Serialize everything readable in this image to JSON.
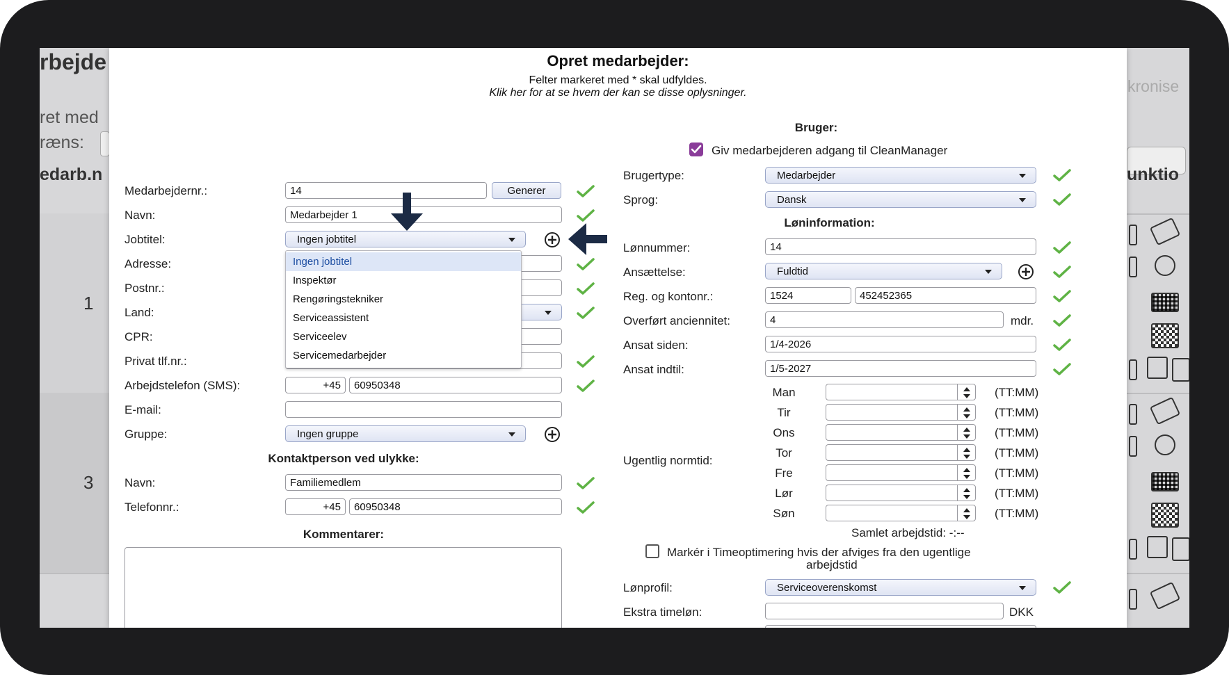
{
  "background": {
    "title_fragment": "rbejde",
    "create_fragment": "ret med",
    "limit_fragment": "ræns:",
    "column_fragment": "edarb.n",
    "sync_fragment": "kronise",
    "function_fragment": "unktio",
    "row_numbers": [
      "1",
      "3"
    ]
  },
  "modal": {
    "title": "Opret medarbejder:",
    "required_note": "Felter markeret med * skal udfyldes.",
    "visibility_link": "Klik her for at se hvem der kan se disse oplysninger.",
    "left": {
      "employee_no_label": "Medarbejdernr.:",
      "employee_no_value": "14",
      "generate_button": "Generer",
      "name_label": "Navn:",
      "name_value": "Medarbejder 1",
      "jobtitle_label": "Jobtitel:",
      "jobtitle_value": "Ingen jobtitel",
      "address_label": "Adresse:",
      "postal_label": "Postnr.:",
      "country_label": "Land:",
      "cpr_label": "CPR:",
      "private_phone_label": "Privat tlf.nr.:",
      "work_phone_label": "Arbejdstelefon (SMS):",
      "work_phone_prefix": "+45",
      "work_phone_value": "60950348",
      "email_label": "E-mail:",
      "group_label": "Gruppe:",
      "group_value": "Ingen gruppe",
      "contact_heading": "Kontaktperson ved ulykke:",
      "contact_name_label": "Navn:",
      "contact_name_value": "Familiemedlem",
      "contact_phone_label": "Telefonnr.:",
      "contact_phone_prefix": "+45",
      "contact_phone_value": "60950348",
      "comments_heading": "Kommentarer:"
    },
    "jobtitle_options": [
      "Ingen jobtitel",
      "Inspektør",
      "Rengøringstekniker",
      "Serviceassistent",
      "Serviceelev",
      "Servicemedarbejder"
    ],
    "right": {
      "user_heading": "Bruger:",
      "access_label": "Giv medarbejderen adgang til CleanManager",
      "usertype_label": "Brugertype:",
      "usertype_value": "Medarbejder",
      "language_label": "Sprog:",
      "language_value": "Dansk",
      "salary_heading": "Løninformation:",
      "salary_no_label": "Lønnummer:",
      "salary_no_value": "14",
      "employment_label": "Ansættelse:",
      "employment_value": "Fuldtid",
      "reg_label": "Reg. og kontonr.:",
      "reg_value": "1524",
      "account_value": "452452365",
      "seniority_label": "Overført anciennitet:",
      "seniority_value": "4",
      "seniority_unit": "mdr.",
      "employed_since_label": "Ansat siden:",
      "employed_since_value": "1/4-2026",
      "employed_until_label": "Ansat indtil:",
      "employed_until_value": "1/5-2027",
      "weekly_label": "Ugentlig normtid:",
      "days": [
        "Man",
        "Tir",
        "Ons",
        "Tor",
        "Fre",
        "Lør",
        "Søn"
      ],
      "time_format": "(TT:MM)",
      "total_label": "Samlet arbejdstid: -:--",
      "timeopt_label": "Markér i Timeoptimering hvis der afviges fra den ugentlige",
      "timeopt_label2": "arbejdstid",
      "payprofile_label": "Lønprofil:",
      "payprofile_value": "Serviceoverenskomst",
      "extra_pay_label": "Ekstra timeløn:",
      "extra_pay_unit": "DKK"
    }
  },
  "colors": {
    "check_green": "#5fb345",
    "checkbox_purple": "#8a3c99",
    "arrow_navy": "#1c2b45"
  }
}
